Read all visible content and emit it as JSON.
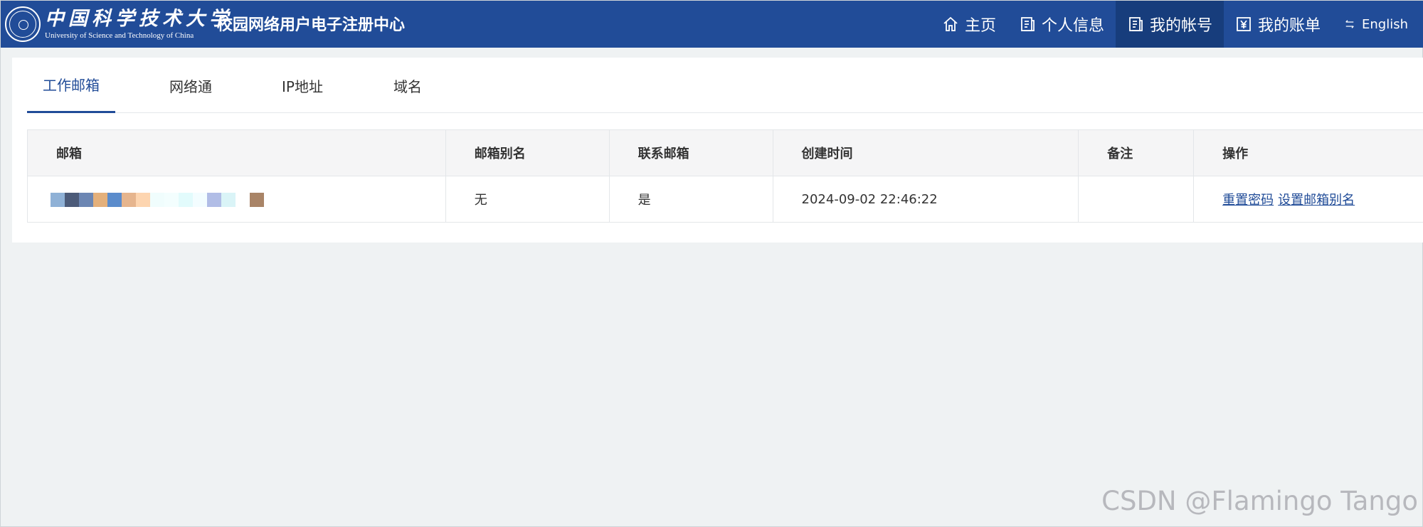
{
  "header": {
    "logo_cn": "中国科学技术大学",
    "logo_en": "University of Science and Technology of China",
    "site_title": "校园网络用户电子注册中心"
  },
  "nav": [
    {
      "label": "主页",
      "icon": "home-icon"
    },
    {
      "label": "个人信息",
      "icon": "profile-icon"
    },
    {
      "label": "我的帐号",
      "icon": "account-icon",
      "active": true
    },
    {
      "label": "我的账单",
      "icon": "bill-icon"
    },
    {
      "label": "English",
      "icon": "language-switch-icon"
    }
  ],
  "tabs": [
    {
      "label": "工作邮箱",
      "active": true
    },
    {
      "label": "网络通"
    },
    {
      "label": "IP地址"
    },
    {
      "label": "域名"
    }
  ],
  "table": {
    "headers": [
      "邮箱",
      "邮箱别名",
      "联系邮箱",
      "创建时间",
      "备注",
      "操作"
    ],
    "rows": [
      {
        "mailbox": "",
        "alias": "无",
        "contact": "是",
        "created": "2024-09-02 22:46:22",
        "note": "",
        "actions": [
          "重置密码",
          "设置邮箱别名"
        ]
      }
    ]
  },
  "watermark": "CSDN @Flamingo Tango",
  "colors": {
    "brand": "#214c98",
    "nav_active": "#173d7c",
    "page_bg": "#eff2f3"
  }
}
